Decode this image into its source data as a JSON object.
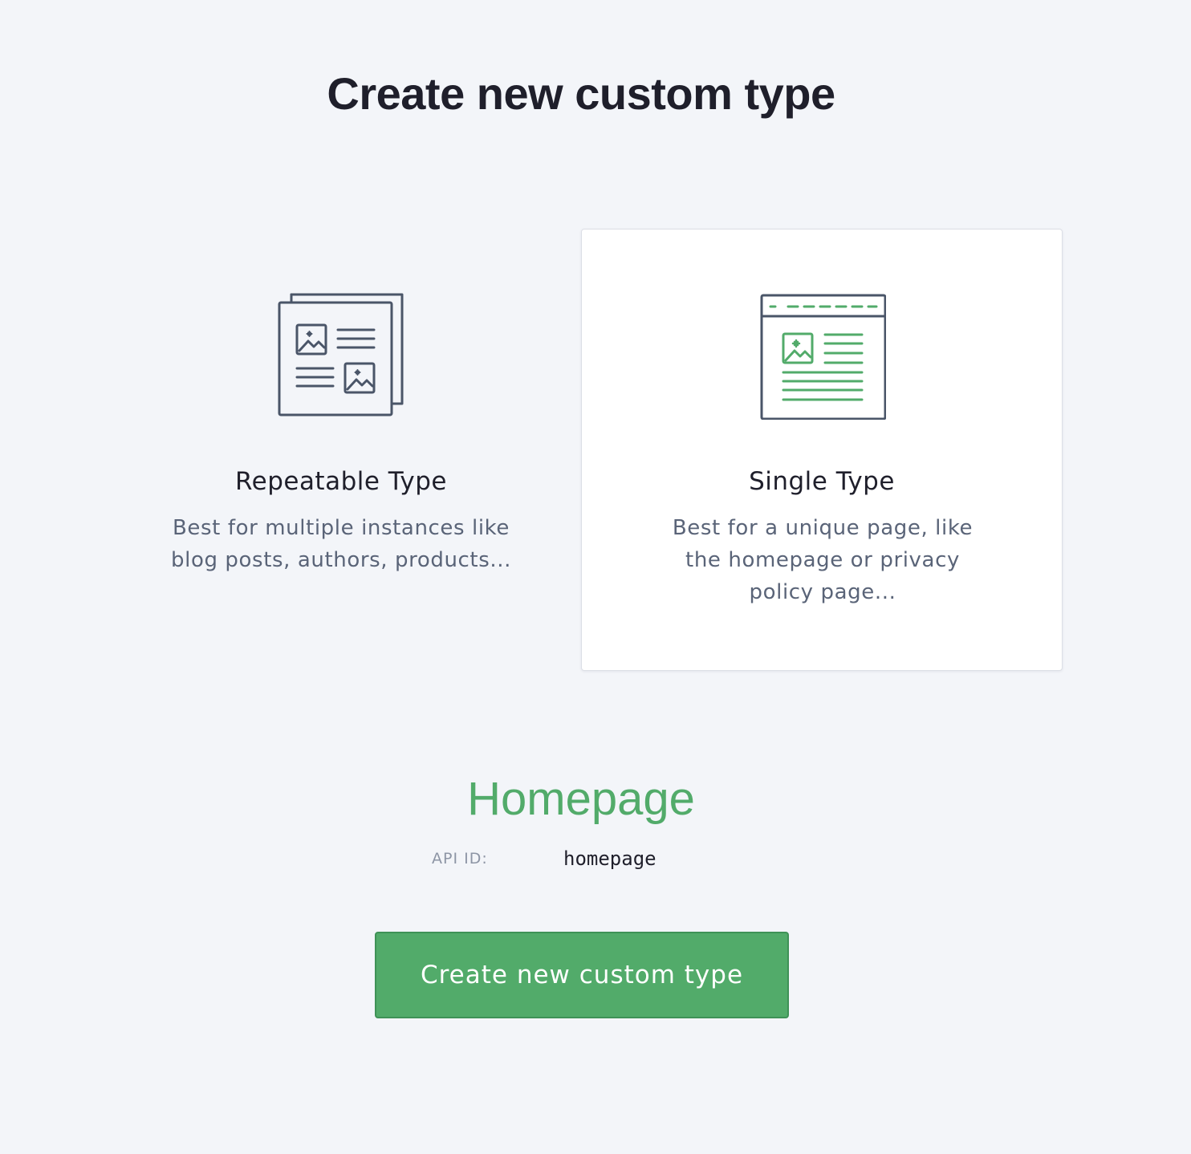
{
  "page": {
    "title": "Create new custom type"
  },
  "types": [
    {
      "id": "repeatable",
      "title": "Repeatable Type",
      "description": "Best for multiple instances like blog posts, authors, products...",
      "icon": "repeatable-documents-icon",
      "selected": false
    },
    {
      "id": "single",
      "title": "Single Type",
      "description": "Best for a unique page, like the homepage or privacy policy page...",
      "icon": "single-page-icon",
      "selected": true
    }
  ],
  "custom_type": {
    "name": "Homepage",
    "api_id_label": "API ID:",
    "api_id_value": "homepage"
  },
  "actions": {
    "create_label": "Create new custom type"
  },
  "colors": {
    "accent": "#52ab6a",
    "icon_stroke": "#4a5568",
    "background": "#f3f5f9"
  }
}
